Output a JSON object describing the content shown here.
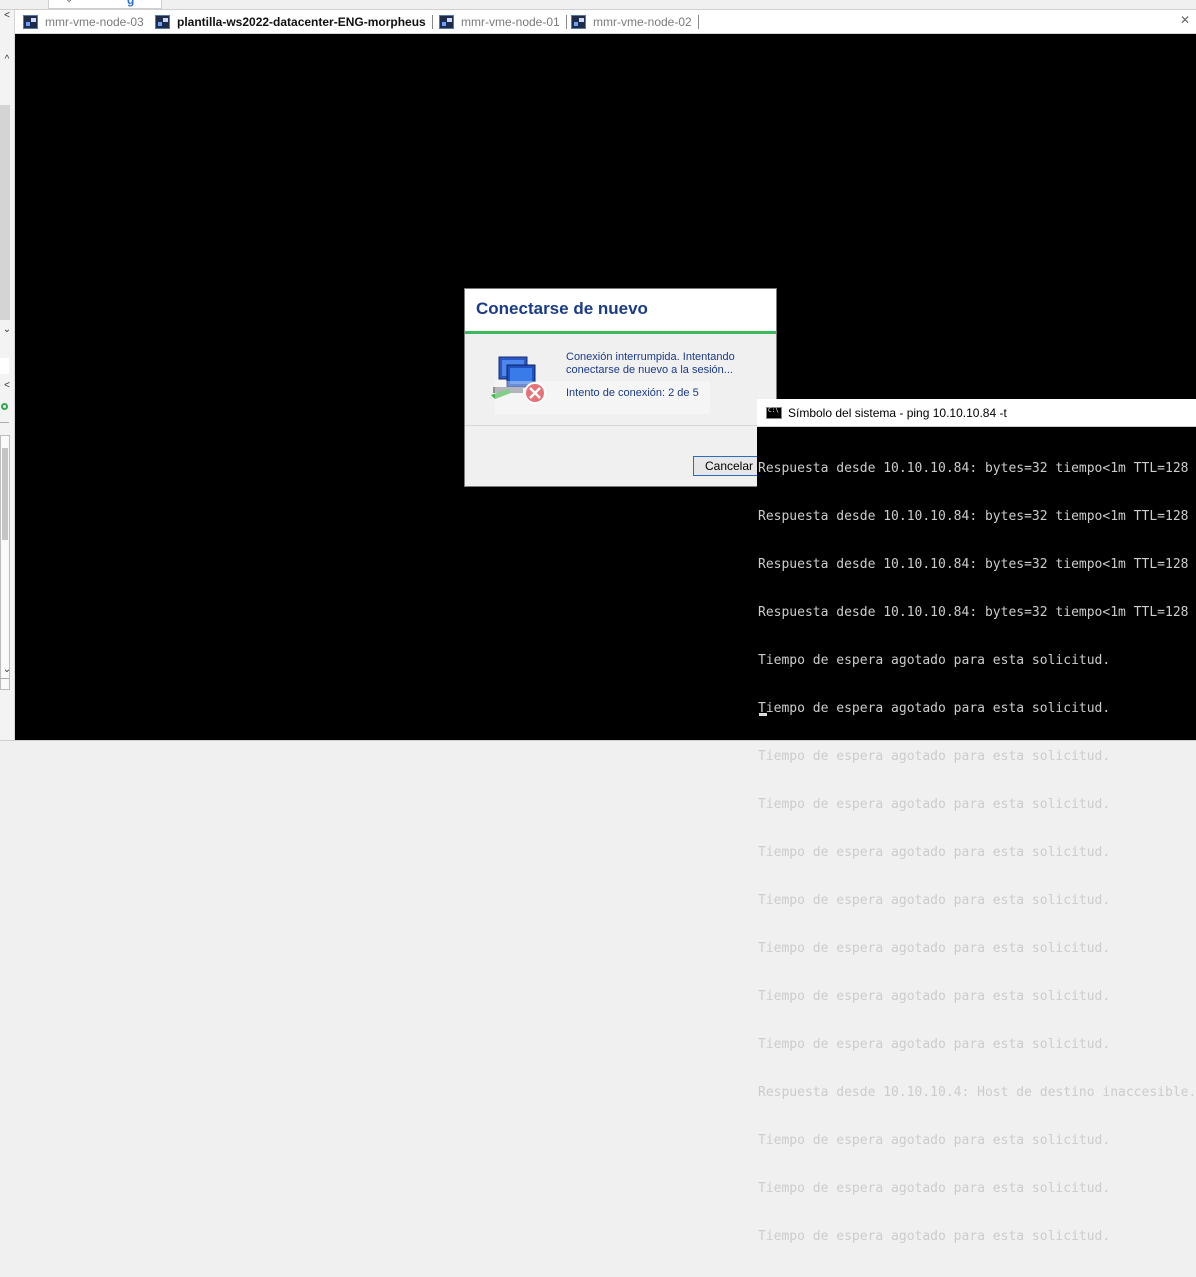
{
  "tabs": [
    {
      "label": "mmr-vme-node-03",
      "active": false
    },
    {
      "label": "plantilla-ws2022-datacenter-ENG-morpheus",
      "active": true
    },
    {
      "label": "mmr-vme-node-01",
      "active": false
    },
    {
      "label": "mmr-vme-node-02",
      "active": false
    }
  ],
  "dialog": {
    "title": "Conectarse de nuevo",
    "message": "Conexión interrumpida. Intentando conectarse de nuevo a la sesión...",
    "attempt": "Intento de conexión: 2 de 5",
    "cancel_label": "Cancelar"
  },
  "cmd": {
    "title": "Símbolo del sistema - ping  10.10.10.84 -t",
    "lines": [
      "Respuesta desde 10.10.10.84: bytes=32 tiempo<1m TTL=128",
      "Respuesta desde 10.10.10.84: bytes=32 tiempo<1m TTL=128",
      "Respuesta desde 10.10.10.84: bytes=32 tiempo<1m TTL=128",
      "Respuesta desde 10.10.10.84: bytes=32 tiempo<1m TTL=128",
      "Tiempo de espera agotado para esta solicitud.",
      "Tiempo de espera agotado para esta solicitud.",
      "Tiempo de espera agotado para esta solicitud.",
      "Tiempo de espera agotado para esta solicitud.",
      "Tiempo de espera agotado para esta solicitud.",
      "Tiempo de espera agotado para esta solicitud.",
      "Tiempo de espera agotado para esta solicitud.",
      "Tiempo de espera agotado para esta solicitud.",
      "Tiempo de espera agotado para esta solicitud.",
      "Respuesta desde 10.10.10.4: Host de destino inaccesible.",
      "Tiempo de espera agotado para esta solicitud.",
      "Tiempo de espera agotado para esta solicitud.",
      "Tiempo de espera agotado para esta solicitud."
    ]
  },
  "icons": {
    "tab_icon": "remote-desktop-icon",
    "dialog_icon": "disconnected-computer-icon",
    "cmd_icon": "command-prompt-icon",
    "close_icon": "close-icon"
  },
  "colors": {
    "dialog_title": "#1a3b8a",
    "dialog_accent": "#3cb95c",
    "screen_bg": "#000000",
    "console_text": "#cccccc"
  }
}
